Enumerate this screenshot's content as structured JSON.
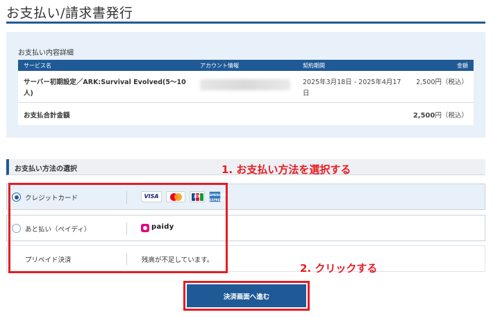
{
  "page": {
    "title": "お支払い/請求書発行"
  },
  "payment_detail": {
    "heading": "お支払い内容詳細",
    "columns": [
      "サービス名",
      "アカウント情報",
      "契約期間",
      "金額"
    ],
    "service_row": {
      "service": "サーバー初期設定／ARK:Survival Evolved(5〜10人)",
      "period": "2025年3月18日 - 2025年4月17日",
      "amount": "2,500円（税込）"
    },
    "total": {
      "label": "お支払合計金額",
      "amount_value": "2,500",
      "amount_unit": "円（税込）"
    }
  },
  "payment_method": {
    "heading": "お支払い方法の選択",
    "options": [
      {
        "label": "クレジットカード",
        "selected": true,
        "icons": [
          "visa-card-icon",
          "mastercard-icon",
          "jcb-card-icon",
          "amex-card-icon"
        ]
      },
      {
        "label": "あと払い（ペイディ）",
        "selected": false,
        "logo_text": "paidy"
      },
      {
        "label": "プリペイド決済",
        "selected": false,
        "info": "残高が不足しています。"
      }
    ],
    "card_texts": {
      "visa": "VISA",
      "jcb": "JCB",
      "amex": "AMERICAN EXPRESS"
    }
  },
  "annotations": {
    "step1": "1. お支払い方法を選択する",
    "step2": "2. クリックする"
  },
  "actions": {
    "proceed_label": "決済画面へ進む"
  },
  "colors": {
    "primary": "#1f5a96",
    "annotation": "#e51c23",
    "panel": "#e8f1f9",
    "paidy": "#e5007e"
  }
}
